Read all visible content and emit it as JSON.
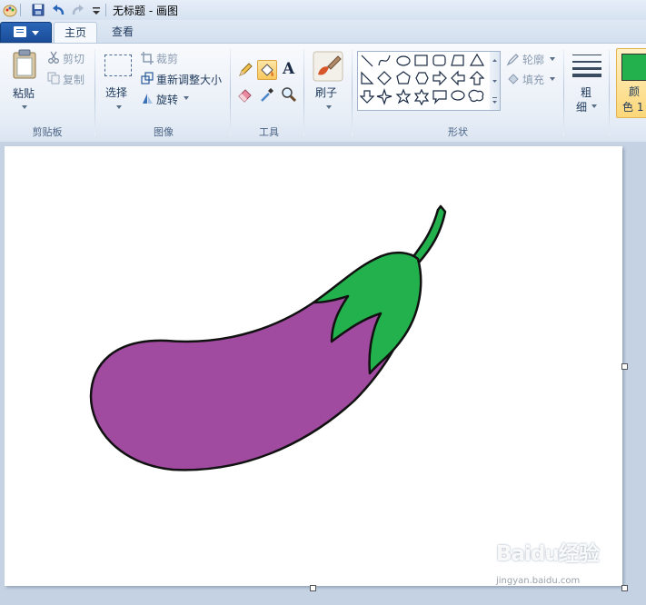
{
  "window": {
    "title": "无标题 - 画图"
  },
  "tabs": [
    {
      "label": "主页"
    },
    {
      "label": "查看"
    }
  ],
  "clipboard": {
    "paste_label": "粘贴",
    "cut_label": "剪切",
    "copy_label": "复制",
    "group_label": "剪贴板"
  },
  "image": {
    "select_label": "选择",
    "crop_label": "裁剪",
    "resize_label": "重新调整大小",
    "rotate_label": "旋转",
    "group_label": "图像"
  },
  "tools": {
    "group_label": "工具",
    "items": [
      "pencil-icon",
      "fill-icon",
      "text-icon",
      "eraser-icon",
      "color-picker-icon",
      "magnifier-icon"
    ],
    "text_glyph": "A"
  },
  "brushes": {
    "label": "刷子"
  },
  "shapes": {
    "outline_label": "轮廓",
    "fill_label": "填充",
    "group_label": "形状"
  },
  "size": {
    "label_line1": "粗",
    "label_line2": "细"
  },
  "colors": {
    "label_line1": "颜",
    "label_line2": "色 1",
    "color1": "#22b14c",
    "eggplant_body": "#a04aa0",
    "eggplant_cap": "#22b14c"
  },
  "watermark": {
    "logo": "Baidu经验",
    "sub": "jingyan.baidu.com"
  }
}
